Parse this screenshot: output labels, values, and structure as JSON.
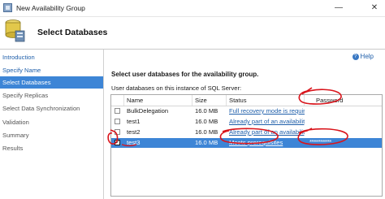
{
  "window": {
    "title": "New Availability Group",
    "minimize": "—",
    "close": "✕"
  },
  "header": {
    "title": "Select Databases",
    "icon": "database-icon"
  },
  "sidebar": {
    "items": [
      {
        "label": "Introduction",
        "state": "link"
      },
      {
        "label": "Specify Name",
        "state": "link"
      },
      {
        "label": "Select Databases",
        "state": "active"
      },
      {
        "label": "Specify Replicas",
        "state": "dim"
      },
      {
        "label": "Select Data Synchronization",
        "state": "dim"
      },
      {
        "label": "Validation",
        "state": "dim"
      },
      {
        "label": "Summary",
        "state": "dim"
      },
      {
        "label": "Results",
        "state": "dim"
      }
    ]
  },
  "main": {
    "help_label": "Help",
    "heading": "Select user databases for the availability group.",
    "grid_caption": "User databases on this instance of SQL Server:",
    "columns": {
      "name": "Name",
      "size": "Size",
      "status": "Status",
      "password": "Password"
    },
    "rows": [
      {
        "checked": false,
        "name": "BulkDelegation",
        "size": "16.0 MB",
        "status": "Full recovery mode is required",
        "password": ""
      },
      {
        "checked": false,
        "name": "test1",
        "size": "16.0 MB",
        "status": "Already part of an availability ...",
        "password": ""
      },
      {
        "checked": false,
        "name": "test2",
        "size": "16.0 MB",
        "status": "Already part of an availability ...",
        "password": ""
      },
      {
        "checked": true,
        "name": "test3",
        "size": "16.0 MB",
        "status": "Meets prerequisites",
        "password": "************"
      }
    ]
  },
  "colors": {
    "accent": "#3d85d6",
    "link": "#1f5faa",
    "annotation": "#d9141b"
  }
}
